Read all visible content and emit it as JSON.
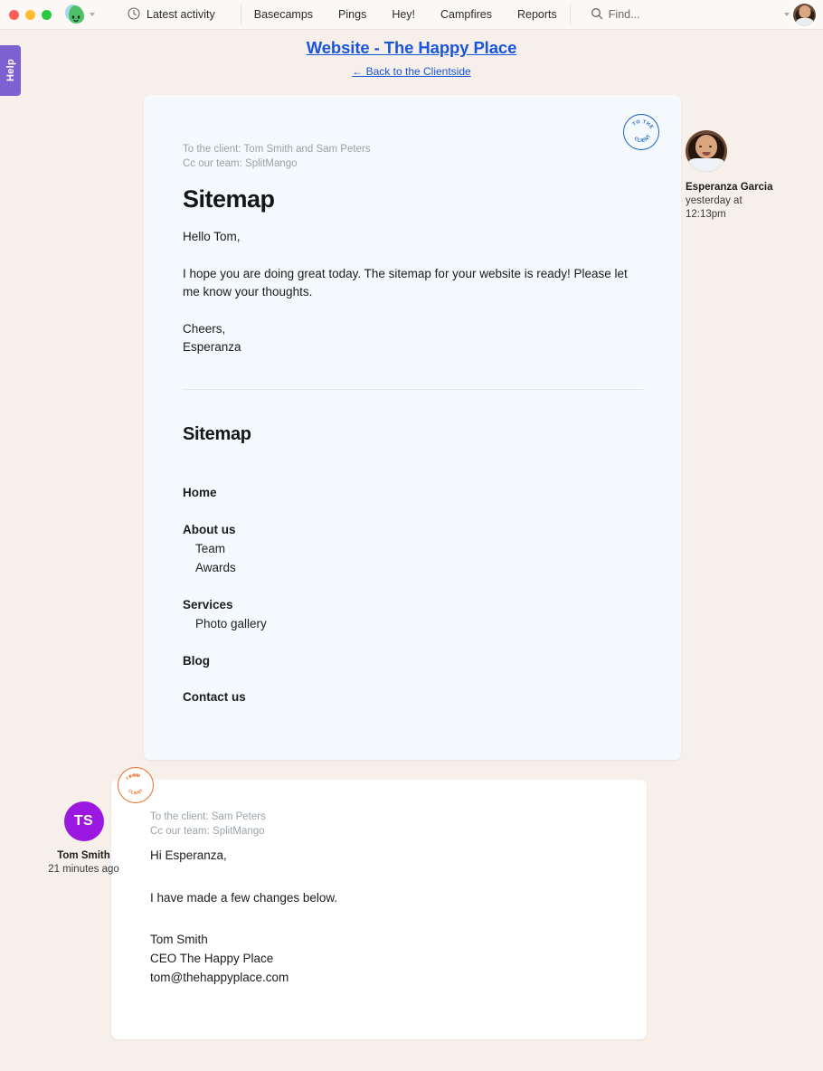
{
  "topbar": {
    "window_controls": [
      "close",
      "minimize",
      "maximize"
    ],
    "logo_name": "basecamp-logo",
    "latest_activity": "Latest activity",
    "nav_items": [
      {
        "label": "Basecamps",
        "name": "nav-basecamps"
      },
      {
        "label": "Pings",
        "name": "nav-pings"
      },
      {
        "label": "Hey!",
        "name": "nav-hey"
      },
      {
        "label": "Campfires",
        "name": "nav-campfires"
      },
      {
        "label": "Reports",
        "name": "nav-reports"
      }
    ],
    "find_label": "Find...",
    "avatar_name": "user-avatar"
  },
  "help_tab": {
    "label": "Help",
    "color": "#7d61d0"
  },
  "page": {
    "title": "Website - The Happy Place",
    "back_link": "← Back to the Clientside",
    "title_color": "#1a56db",
    "background": "#f7efe9"
  },
  "message_one": {
    "stamp": "TO THE CLIENT",
    "stamp_color": "#1f63c4",
    "to_line": "To the client: Tom Smith and Sam Peters",
    "cc_line": "Cc our team: SplitMango",
    "title": "Sitemap",
    "paragraphs": [
      "Hello Tom,",
      "I hope you are doing great today. The sitemap for your website is ready! Please let me know your thoughts.",
      "Cheers,\nEsperanza"
    ],
    "sitemap_heading": "Sitemap",
    "sitemap": [
      {
        "label": "Home",
        "children": []
      },
      {
        "label": "About us",
        "children": [
          "Team",
          "Awards"
        ]
      },
      {
        "label": "Services",
        "children": [
          "Photo gallery"
        ]
      },
      {
        "label": "Blog",
        "children": []
      },
      {
        "label": "Contact us",
        "children": []
      }
    ],
    "author": {
      "name": "Esperanza Garcia",
      "time": "yesterday at\n12:13pm"
    },
    "card_color": "#f3f9fc"
  },
  "message_two": {
    "stamp": "FROM THE CLIENT",
    "stamp_color": "#e8702a",
    "to_line": "To the client: Sam Peters",
    "cc_line": "Cc our team: SplitMango",
    "paragraphs": [
      "Hi Esperanza,",
      "I have made a few changes below."
    ],
    "signature": "Tom Smith\nCEO The Happy Place\ntom@thehappyplace.com",
    "author": {
      "name": "Tom Smith",
      "time": "21 minutes ago",
      "initials": "TS",
      "avatar_color": "#9b18e0"
    },
    "card_color": "#ffffff"
  }
}
